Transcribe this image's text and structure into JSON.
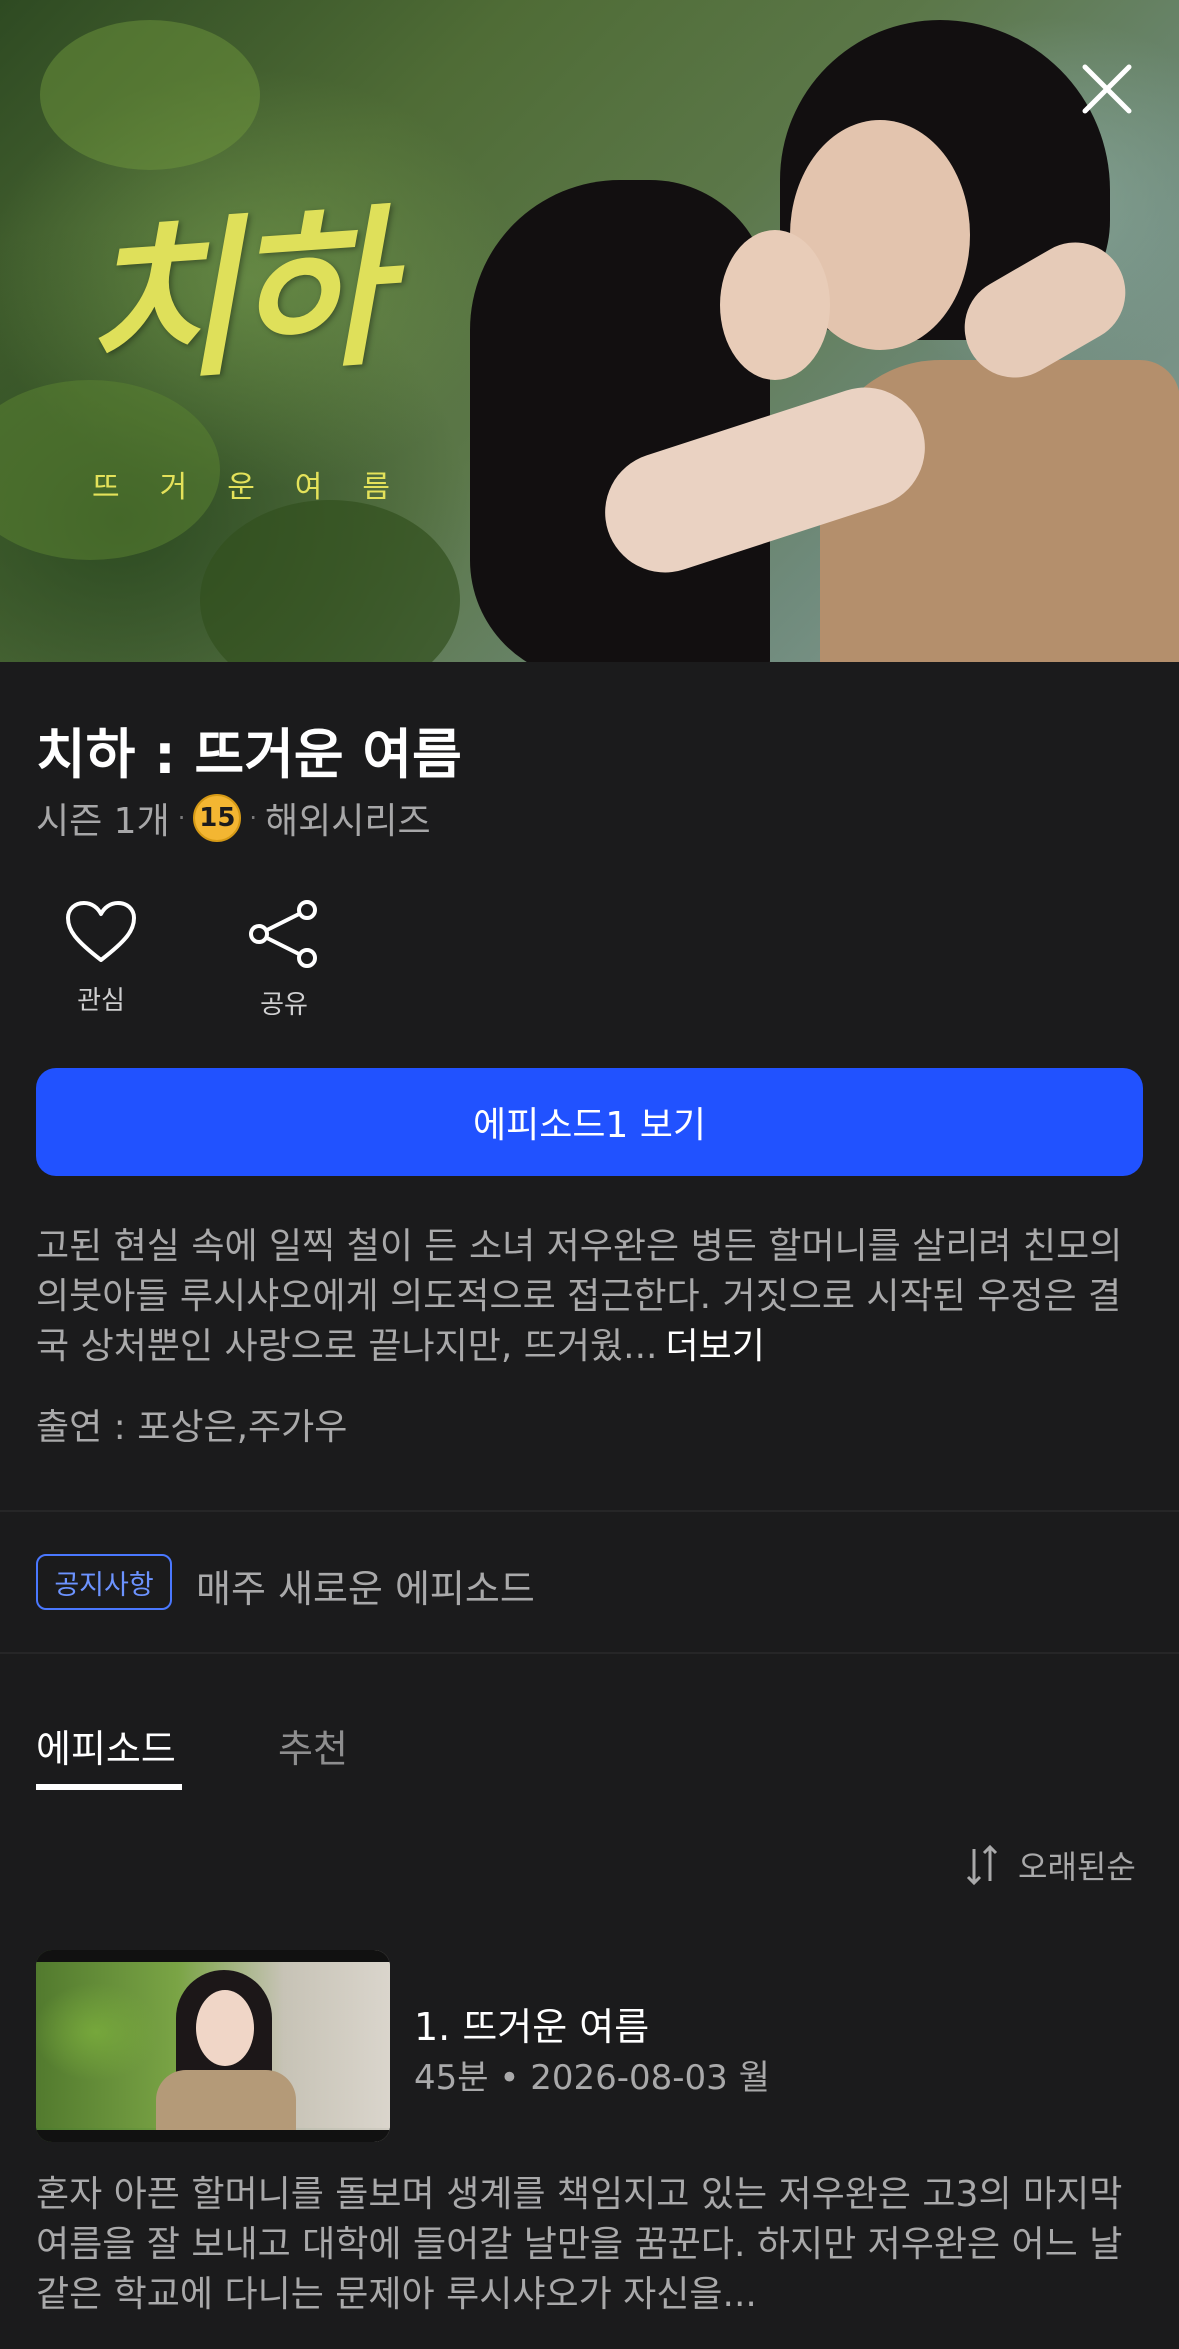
{
  "hero": {
    "title_art": "치하",
    "subtitle_art": "뜨거운여름"
  },
  "show": {
    "title": "치하 : 뜨거운 여름",
    "season_info": "시즌 1개",
    "age_rating": "15",
    "genre": "해외시리즈"
  },
  "actions": {
    "like_label": "관심",
    "share_label": "공유"
  },
  "play_button_label": "에피소드1 보기",
  "synopsis": {
    "text": "고된 현실 속에 일찍 철이 든 소녀 저우완은 병든 할머니를 살리려 친모의 의붓아들 루시샤오에게 의도적으로 접근한다. 거짓으로 시작된 우정은 결국 상처뿐인 사랑으로 끝나지만, 뜨거웠...",
    "more_label": "더보기"
  },
  "cast": "출연 : 포상은,주가우",
  "notice": {
    "badge": "공지사항",
    "text": "매주 새로운 에피소드"
  },
  "tabs": [
    {
      "label": "에피소드",
      "active": true
    },
    {
      "label": "추천",
      "active": false
    }
  ],
  "sort_label": "오래된순",
  "episodes": [
    {
      "title": "1. 뜨거운 여름",
      "meta": "45분 • 2026-08-03 월",
      "description": "혼자 아픈 할머니를 돌보며 생계를 책임지고 있는 저우완은 고3의 마지막 여름을 잘 보내고 대학에 들어갈 날만을 꿈꾼다. 하지만 저우완은 어느 날 같은 학교에 다니는 문제아 루시샤오가 자신을..."
    }
  ],
  "colors": {
    "background": "#1b1b1c",
    "accent": "#2152ff",
    "notice_blue": "#4a78ff",
    "age_badge": "#f3b632"
  }
}
